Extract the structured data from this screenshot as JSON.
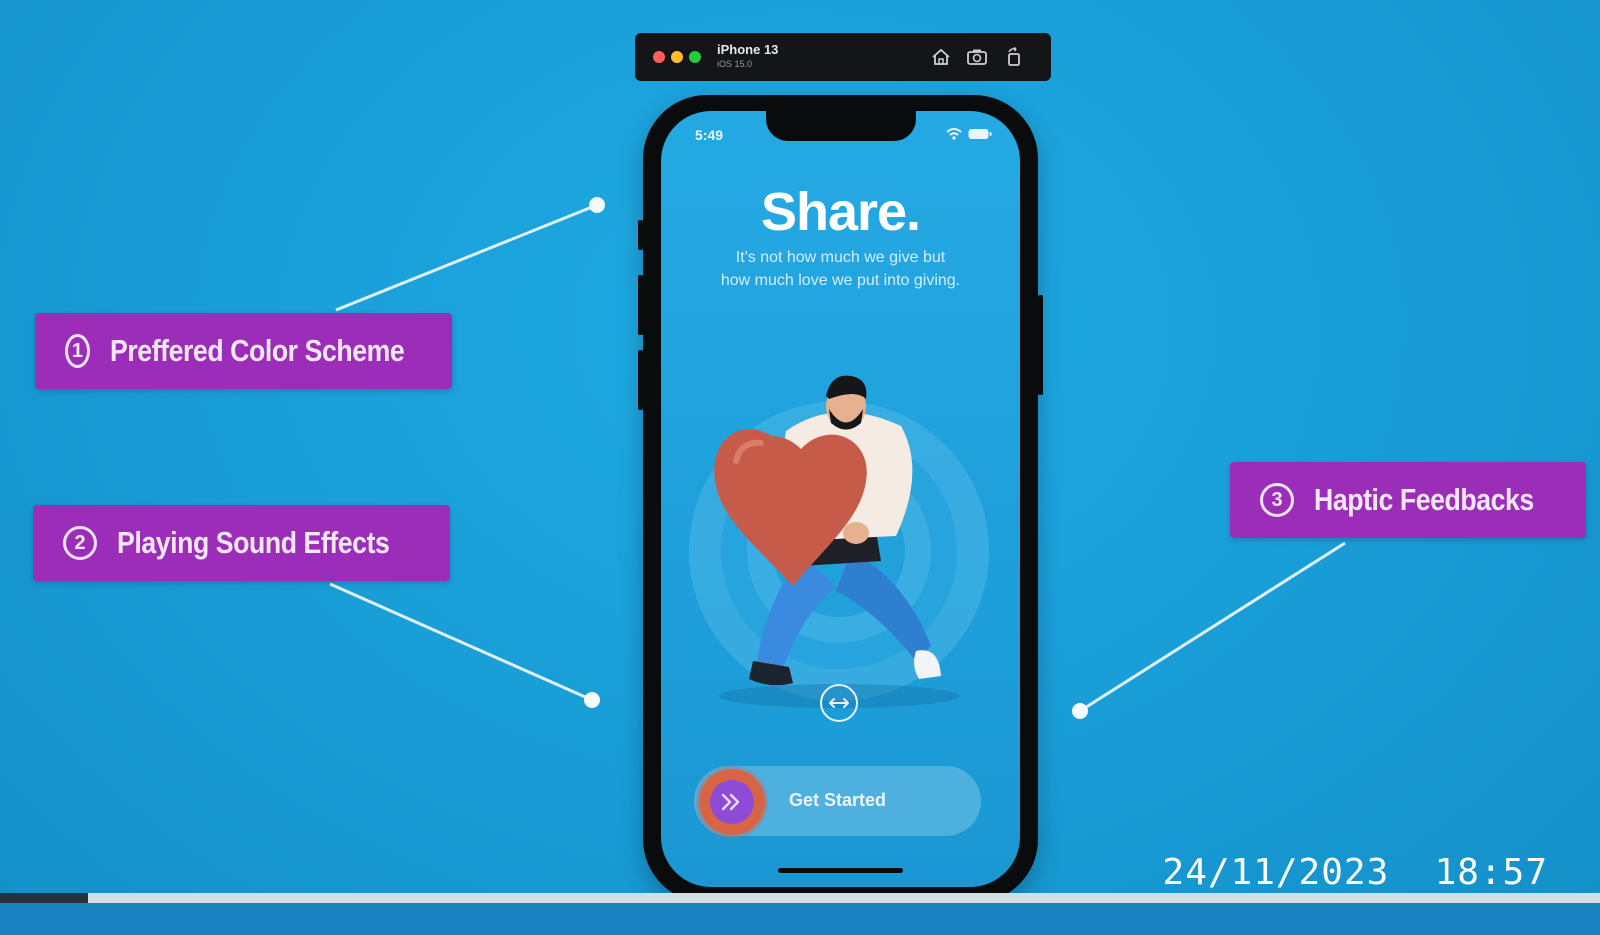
{
  "simulator": {
    "device_name": "iPhone 13",
    "os_version": "iOS 15.0",
    "icons": [
      "home-icon",
      "screenshot-icon",
      "rotate-icon"
    ]
  },
  "callouts": [
    {
      "number": "1",
      "label": "Preffered Color Scheme"
    },
    {
      "number": "2",
      "label": "Playing Sound Effects"
    },
    {
      "number": "3",
      "label": "Haptic Feedbacks"
    }
  ],
  "phone": {
    "status_time": "5:49",
    "title": "Share.",
    "subtitle_line1": "It's not how much we give but",
    "subtitle_line2": "how much love we put into giving.",
    "illustration": "person-carrying-heart",
    "swipe_icon": "swap-arrows-icon",
    "cta_label": "Get Started",
    "cta_icon": "double-chevron-right-icon"
  },
  "overlay": {
    "date": "24/11/2023",
    "time": "18:57",
    "progress": 0.055
  },
  "colors": {
    "background": "#1a9fd9",
    "callout": "#9b2db8",
    "knob": "#d76545",
    "knob_inner": "#8e4bd6"
  }
}
